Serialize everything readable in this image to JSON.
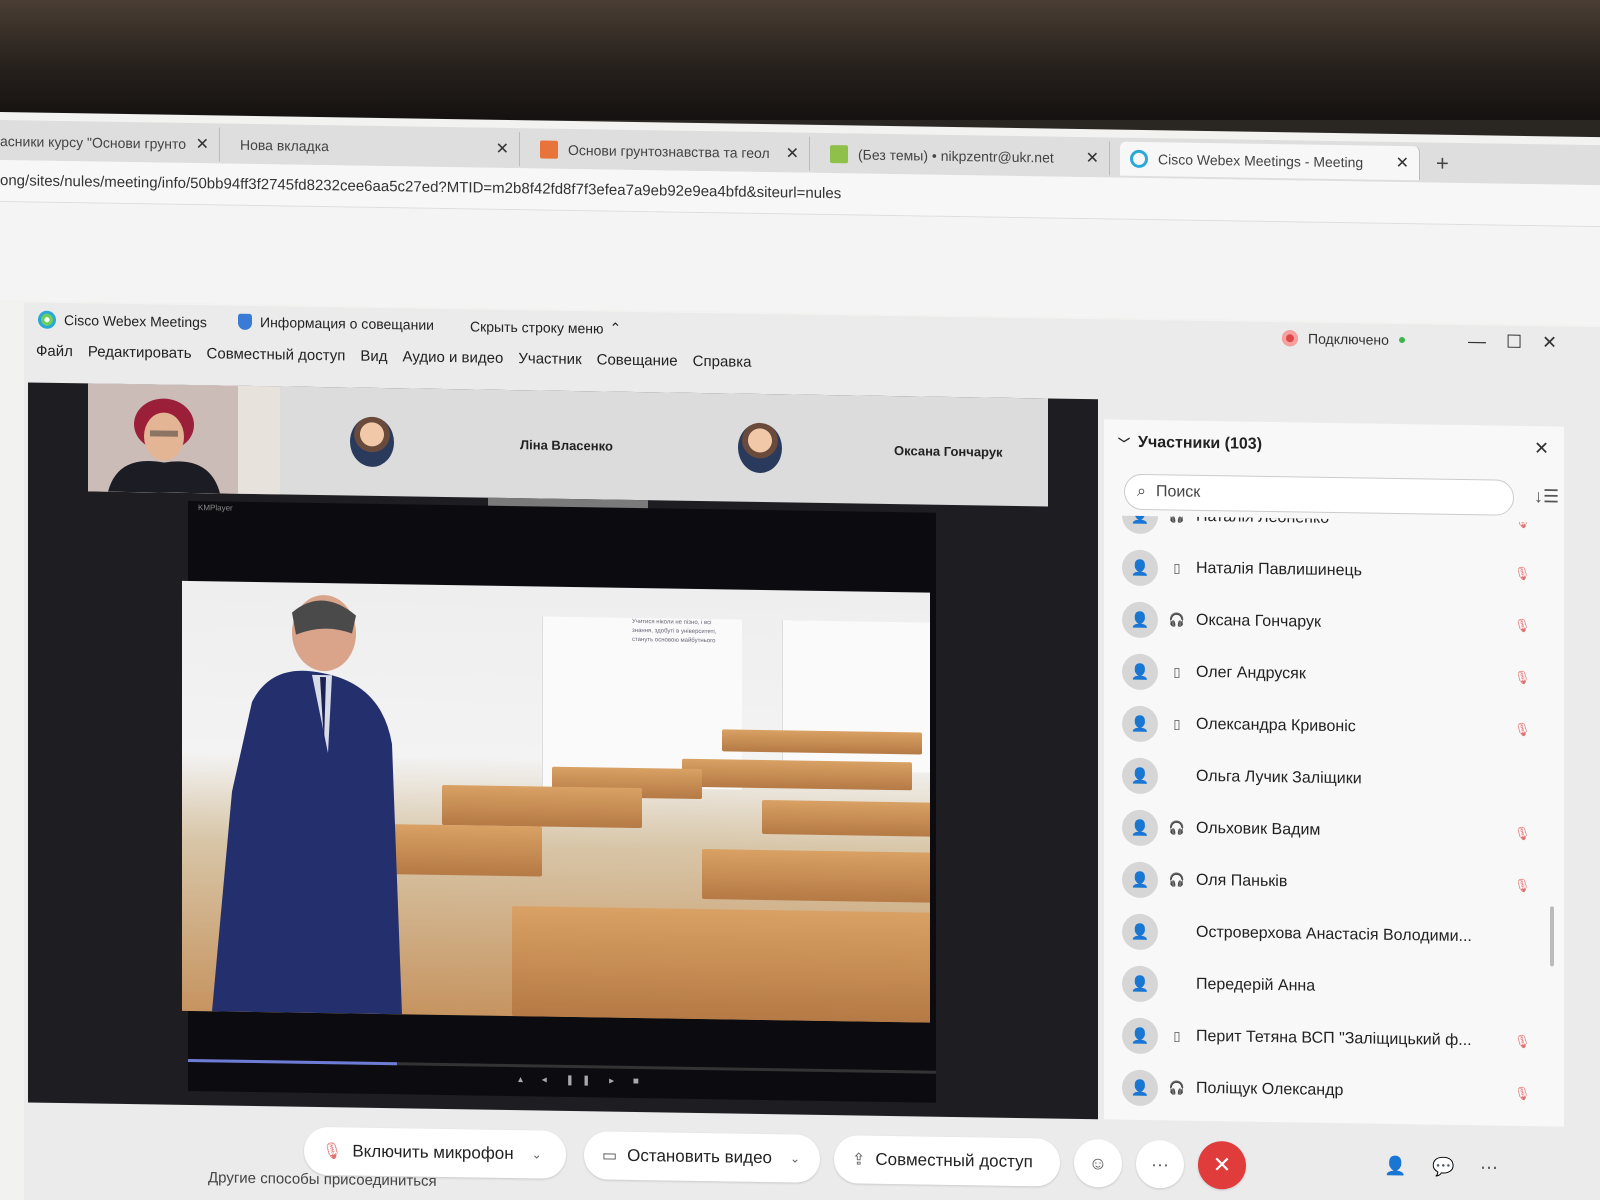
{
  "browser": {
    "tabs": [
      {
        "title": "асники курсу \"Основи грунто",
        "icon": "doc-icon",
        "active": false
      },
      {
        "title": "Нова вкладка",
        "icon": "",
        "active": false
      },
      {
        "title": "Основи грунтознавства та геол",
        "icon": "course-icon",
        "active": false
      },
      {
        "title": "(Без темы) • nikpzentr@ukr.net",
        "icon": "mail-icon",
        "active": false
      },
      {
        "title": "Cisco Webex Meetings - Meeting",
        "icon": "webex-icon",
        "active": true
      }
    ],
    "new_tab_label": "+",
    "url": "ong/sites/nules/meeting/info/50bb94ff3f2745fd8232cee6aa5c27ed?MTID=m2b8f42fd8f7f3efea7a9eb92e9ea4bfd&siteurl=nules"
  },
  "webex": {
    "app_name": "Cisco Webex Meetings",
    "meeting_info": "Информация о совещании",
    "hide_menu": "Скрыть строку меню",
    "status": "Подключено",
    "menu": [
      "Файл",
      "Редактировать",
      "Совместный доступ",
      "Вид",
      "Аудио и видео",
      "Участник",
      "Совещание",
      "Справка"
    ],
    "thumbnails": [
      {
        "name": "Ліна Власенко"
      },
      {
        "name": "Оксана Гончарук"
      }
    ],
    "player_title": "KMPlayer",
    "video_caption": "Учитися ніколи не пізно, і всі знання, здобуті в університеті, стануть основою майбутнього"
  },
  "participants": {
    "header": "Участники (103)",
    "search_placeholder": "Поиск",
    "list": [
      {
        "name": "Наталія Леоненко",
        "device": "headset",
        "muted": true
      },
      {
        "name": "Наталія Павлишинець",
        "device": "phone",
        "muted": true
      },
      {
        "name": "Оксана Гончарук",
        "device": "headset",
        "muted": true
      },
      {
        "name": "Олег Андрусяк",
        "device": "phone",
        "muted": true
      },
      {
        "name": "Олександра Кривоніс",
        "device": "phone",
        "muted": true
      },
      {
        "name": "Ольга Лучик Заліщики",
        "device": "",
        "muted": false
      },
      {
        "name": "Ольховик Вадим",
        "device": "headset",
        "muted": true
      },
      {
        "name": "Оля Паньків",
        "device": "headset",
        "muted": true
      },
      {
        "name": "Островерхова Анастасія Володими...",
        "device": "",
        "muted": false
      },
      {
        "name": "Передерій Анна",
        "device": "",
        "muted": false
      },
      {
        "name": "Перит Тетяна ВСП \"Заліщицький ф...",
        "device": "phone",
        "muted": true
      },
      {
        "name": "Поліщук Олександр",
        "device": "headset",
        "muted": true
      }
    ]
  },
  "controls": {
    "mic": "Включить микрофон",
    "video": "Остановить видео",
    "share": "Совместный доступ",
    "more": "···"
  },
  "footer_text": "Другие способы присоединиться",
  "colors": {
    "accent": "#2aa8d8",
    "end_call": "#e03c3c",
    "muted_mic": "#e07070"
  }
}
